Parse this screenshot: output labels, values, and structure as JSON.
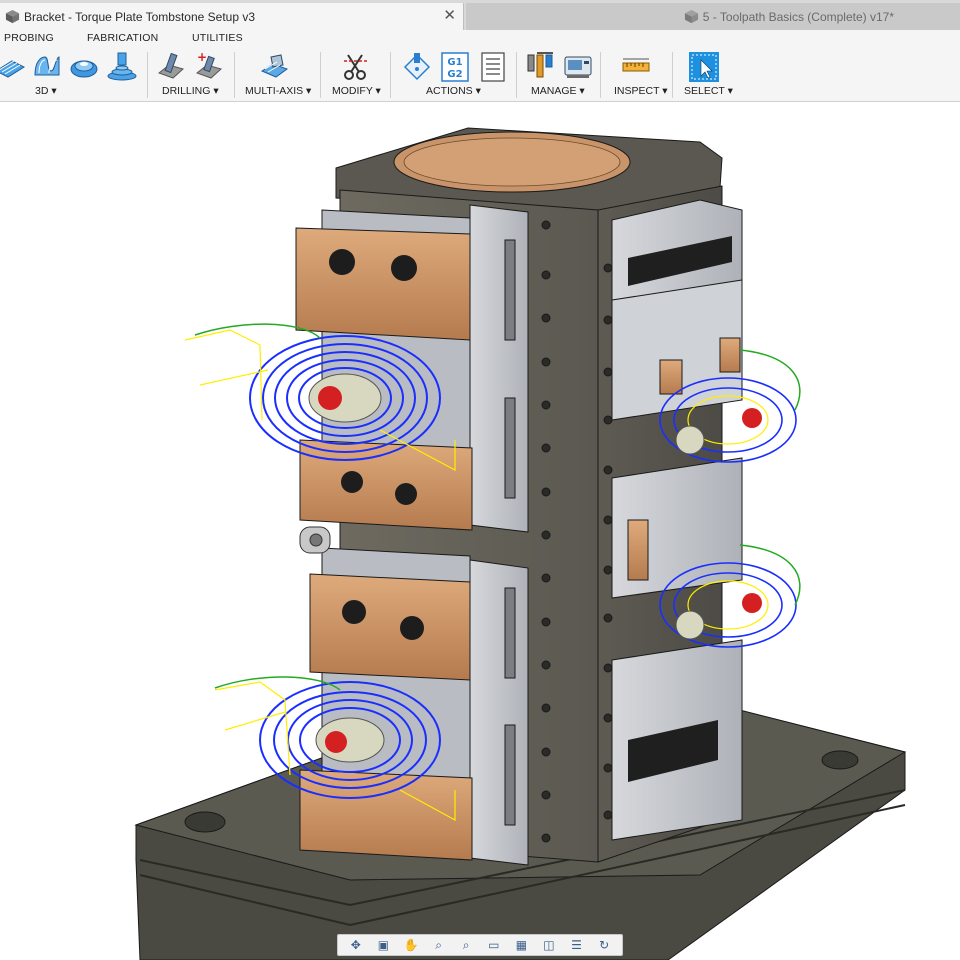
{
  "tabs": [
    {
      "title": "Bracket - Torque Plate Tombstone Setup v3",
      "active": true,
      "close_icon": "close-icon"
    },
    {
      "title": "5 - Toolpath Basics (Complete) v17*",
      "active": false
    }
  ],
  "menu": {
    "probing": "PROBING",
    "fabrication": "FABRICATION",
    "utilities": "UTILITIES"
  },
  "toolbar": {
    "groups": {
      "threed": "3D ▾",
      "drilling": "DRILLING ▾",
      "multiaxis": "MULTI-AXIS ▾",
      "modify": "MODIFY ▾",
      "actions": "ACTIONS ▾",
      "manage": "MANAGE ▾",
      "inspect": "INSPECT ▾",
      "select": "SELECT ▾"
    },
    "g1g2": {
      "line1": "G1",
      "line2": "G2"
    }
  },
  "navbar": {
    "items": [
      "orbit-icon",
      "look-at-icon",
      "pan-icon",
      "zoom-icon",
      "zoom-window-icon",
      "display-settings-icon",
      "grid-icon",
      "view-cube-icon",
      "layout-icon",
      "refresh-icon"
    ]
  },
  "colors": {
    "accent_select": "#1e90e0",
    "toolpath_blue": "#1a2fff",
    "toolpath_yellow": "#ffee00",
    "toolpath_green": "#22aa22",
    "fixture_bronze": "#c8895a",
    "tombstone_gray": "#6a665c"
  }
}
